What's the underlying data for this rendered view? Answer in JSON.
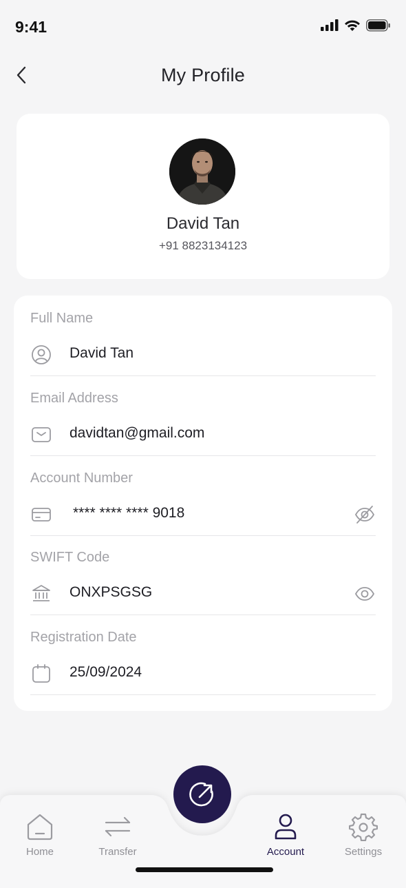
{
  "status_bar": {
    "time": "9:41"
  },
  "header": {
    "title": "My Profile"
  },
  "profile": {
    "name": "David Tan",
    "phone": "+91 8823134123"
  },
  "details": {
    "full_name": {
      "label": "Full Name",
      "value": "David Tan"
    },
    "email": {
      "label": "Email Address",
      "value": "davidtan@gmail.com"
    },
    "account_number": {
      "label": "Account Number",
      "value": "**** **** **** 9018"
    },
    "swift_code": {
      "label": "SWIFT Code",
      "value": "ONXPSGSG"
    },
    "registration_date": {
      "label": "Registration Date",
      "value": "25/09/2024"
    }
  },
  "nav": {
    "items": [
      {
        "label": "Home",
        "icon": "home-icon",
        "active": false
      },
      {
        "label": "Transfer",
        "icon": "transfer-icon",
        "active": false
      },
      {
        "label": "Account",
        "icon": "user-icon",
        "active": true
      },
      {
        "label": "Settings",
        "icon": "gear-icon",
        "active": false
      }
    ],
    "fab_icon": "send-money-icon"
  },
  "colors": {
    "accent": "#231a4e",
    "background": "#f5f5f6",
    "card": "#ffffff",
    "muted_text": "#a3a3a8",
    "icon_gray": "#9b9ba0"
  }
}
